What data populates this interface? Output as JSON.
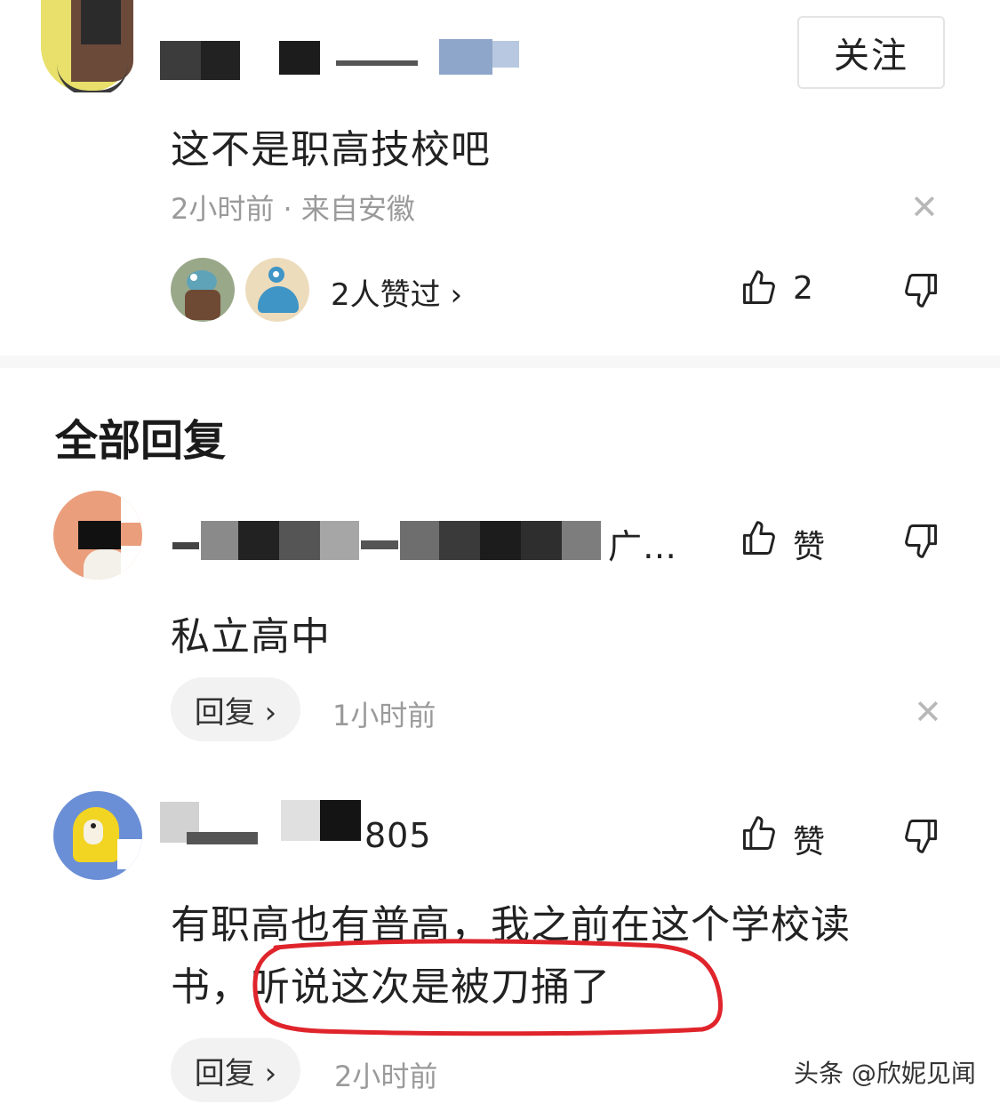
{
  "colors": {
    "circle": "#e0242b",
    "meta": "#9a9a9a",
    "pill": "#f2f2f2"
  },
  "top_comment": {
    "follow_label": "关注",
    "text": "这不是职高技校吧",
    "time_location": "2小时前 · 来自安徽",
    "likers_label": "2人赞过 ›",
    "like_count": "2"
  },
  "section_title": "全部回复",
  "replies": [
    {
      "username_visible": "广…",
      "text": "私立高中",
      "reply_label": "回复 ›",
      "time": "1小时前",
      "like_label": "赞"
    },
    {
      "username_visible": "805",
      "text_line1": "有职高也有普高，我之前在这个学校读",
      "text_line2_prefix": "书，",
      "text_line2_circled": "听说这次是被刀捅了",
      "reply_label": "回复 ›",
      "time": "2小时前",
      "like_label": "赞"
    }
  ],
  "watermark": "头条 @欣妮见闻",
  "icons": [
    "thumbs-up-icon",
    "thumbs-down-icon",
    "close-icon",
    "chevron-right-icon"
  ]
}
